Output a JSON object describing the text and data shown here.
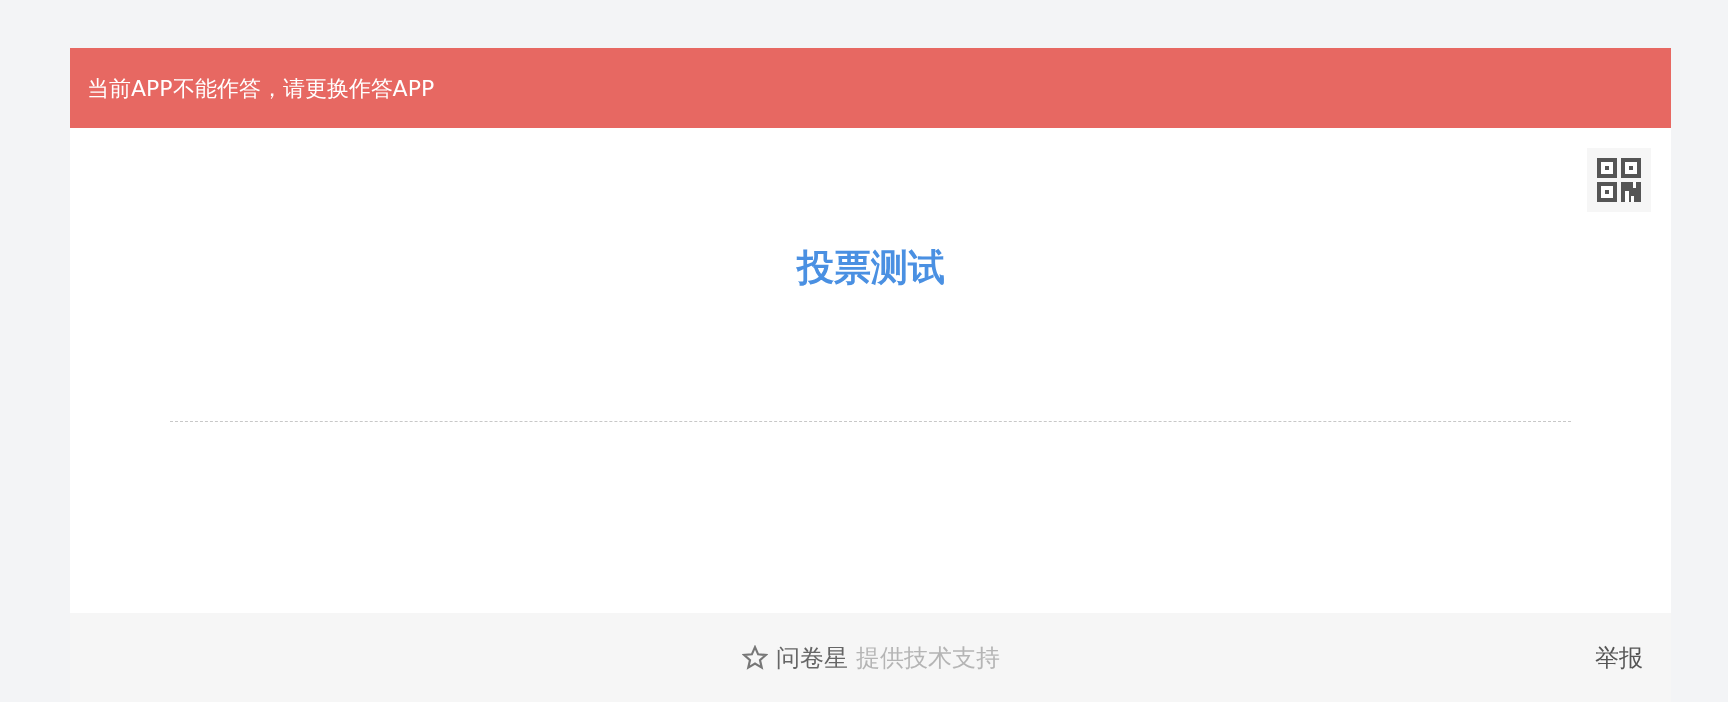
{
  "alert": {
    "text": "当前APP不能作答，请更换作答APP"
  },
  "survey": {
    "title": "投票测试"
  },
  "footer": {
    "brand": "问卷星",
    "support": "提供技术支持",
    "report": "举报"
  }
}
